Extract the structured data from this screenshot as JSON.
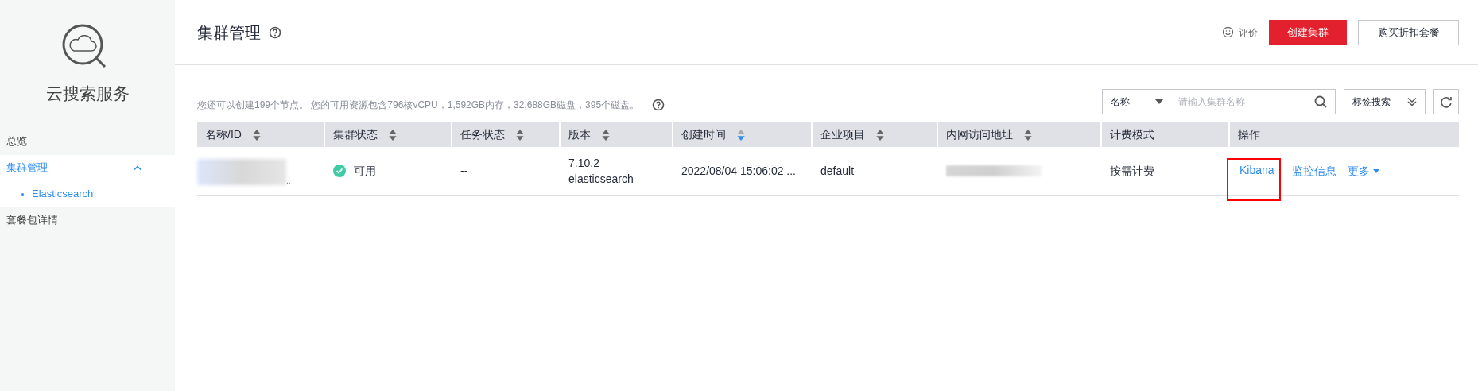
{
  "sidebar": {
    "title": "云搜索服务",
    "items": [
      {
        "label": "总览",
        "selected": false
      },
      {
        "label": "集群管理",
        "selected": true,
        "expanded": true,
        "children": [
          {
            "label": "Elasticsearch",
            "selected": true
          }
        ]
      },
      {
        "label": "套餐包详情",
        "selected": false
      }
    ]
  },
  "header": {
    "title": "集群管理",
    "feedback": "评价",
    "buttons": [
      {
        "label": "创建集群",
        "kind": "primary"
      },
      {
        "label": "购买折扣套餐",
        "kind": "secondary"
      }
    ]
  },
  "quota_text": "您还可以创建199个节点。 您的可用资源包含796核vCPU，1,592GB内存，32,688GB磁盘，395个磁盘。",
  "search": {
    "filter": "名称",
    "placeholder": "请输入集群名称",
    "tag_search": "标签搜索"
  },
  "table": {
    "columns": [
      {
        "label": "名称/ID",
        "sortable": true,
        "sorted": false
      },
      {
        "label": "集群状态",
        "sortable": true,
        "sorted": false
      },
      {
        "label": "任务状态",
        "sortable": true,
        "sorted": false
      },
      {
        "label": "版本",
        "sortable": true,
        "sorted": false
      },
      {
        "label": "创建时间",
        "sortable": true,
        "sorted": true
      },
      {
        "label": "企业项目",
        "sortable": true,
        "sorted": false
      },
      {
        "label": "内网访问地址",
        "sortable": true,
        "sorted": false
      },
      {
        "label": "计费模式",
        "sortable": false
      },
      {
        "label": "操作",
        "sortable": false
      }
    ],
    "rows": [
      {
        "name_suffix": "..",
        "status": {
          "label": "可用",
          "kind": "ok"
        },
        "task": "--",
        "version": [
          "7.10.2",
          "elasticsearch"
        ],
        "created": "2022/08/04 15:06:02 ...",
        "project": "default",
        "billing": "按需计费",
        "actions": [
          {
            "label": "Kibana",
            "kind": "link",
            "highlighted": true
          },
          {
            "label": "监控信息",
            "kind": "link",
            "highlighted": false
          },
          {
            "label": "更多",
            "kind": "menu",
            "highlighted": false
          }
        ]
      }
    ]
  }
}
